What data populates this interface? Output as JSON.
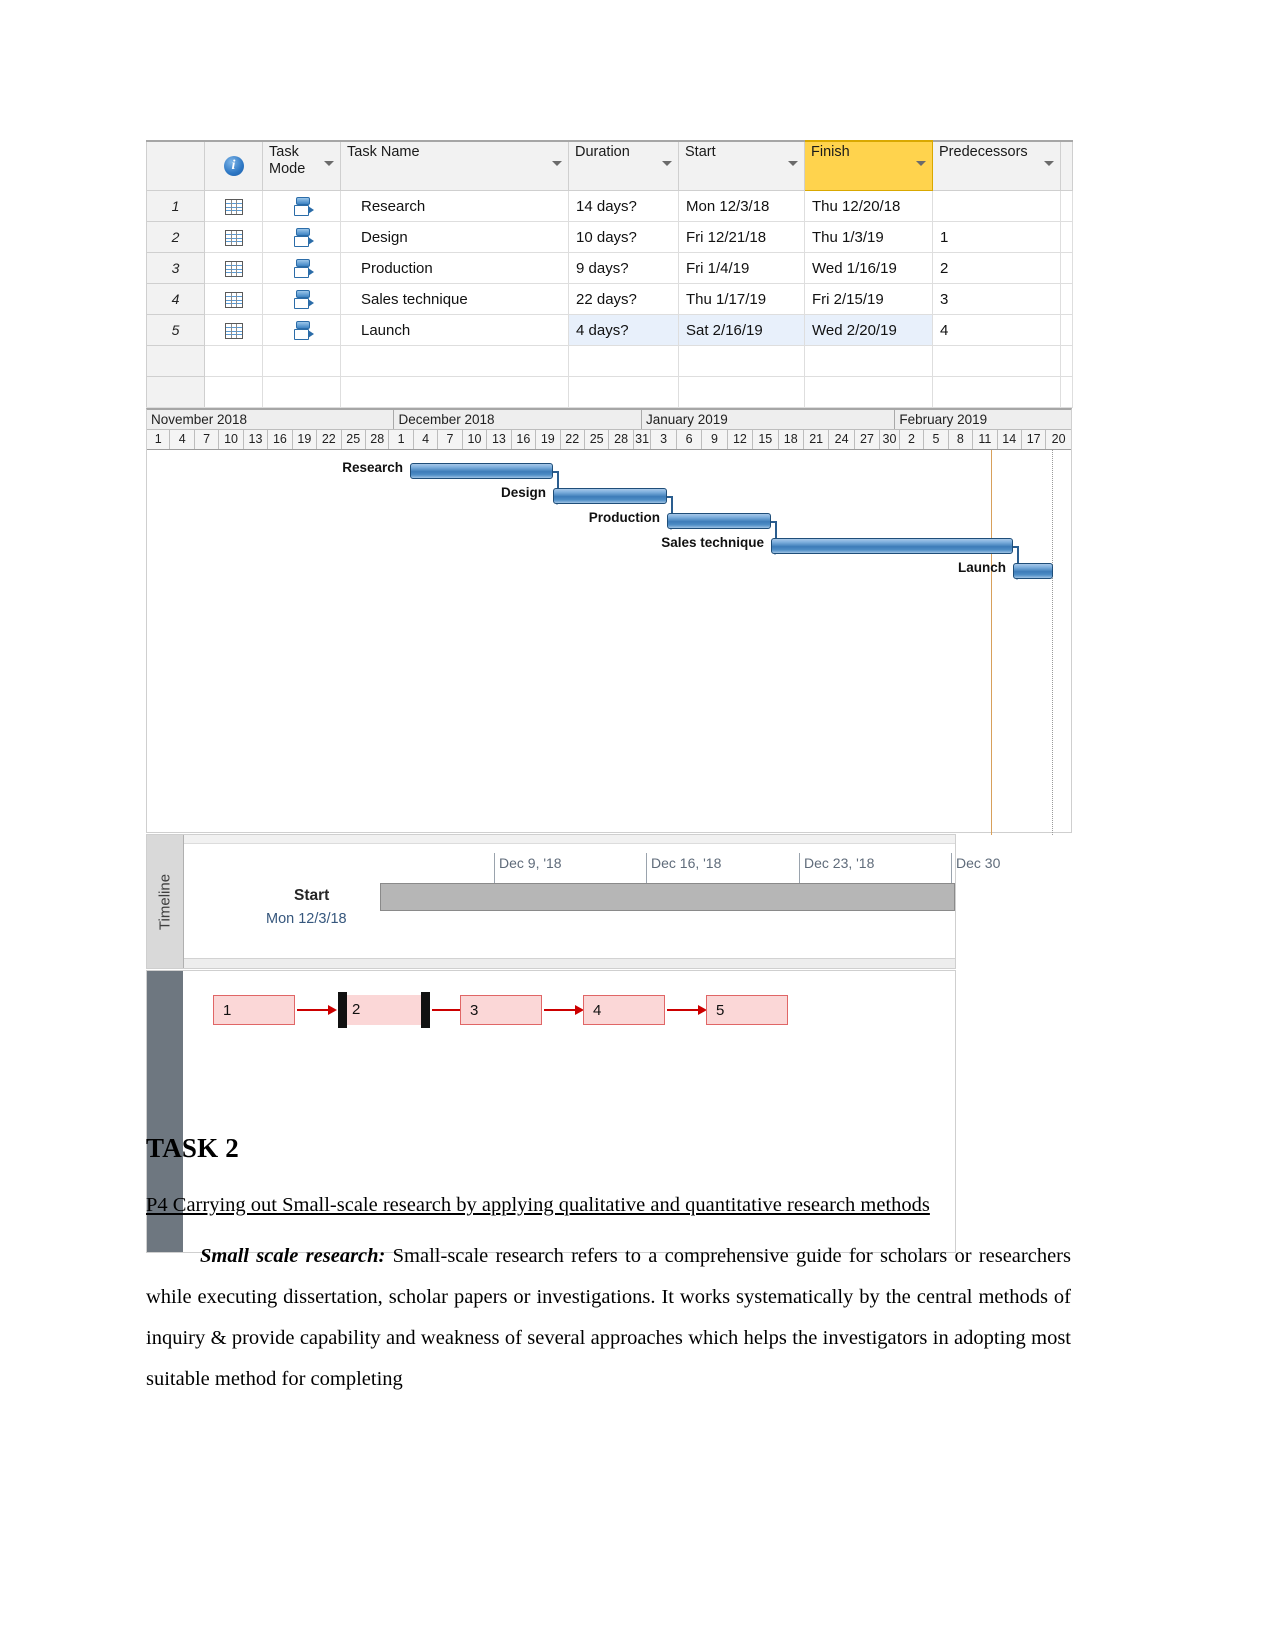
{
  "project": {
    "grid": {
      "columns": [
        {
          "key": "id",
          "label": ""
        },
        {
          "key": "indicator",
          "label": "",
          "icon": "info-icon"
        },
        {
          "key": "mode",
          "label": "Task Mode"
        },
        {
          "key": "name",
          "label": "Task Name"
        },
        {
          "key": "duration",
          "label": "Duration"
        },
        {
          "key": "start",
          "label": "Start"
        },
        {
          "key": "finish",
          "label": "Finish"
        },
        {
          "key": "predecessors",
          "label": "Predecessors"
        }
      ],
      "header_labels": {
        "task_mode": "Task Mode",
        "task_name": "Task Name",
        "duration": "Duration",
        "start": "Start",
        "finish": "Finish",
        "predecessors": "Predecessors"
      },
      "highlight_column": "Finish",
      "highlight_color": "#ffd34d",
      "rows": [
        {
          "id": "1",
          "name": "Research",
          "duration": "14 days?",
          "start": "Mon 12/3/18",
          "finish": "Thu 12/20/18",
          "predecessors": ""
        },
        {
          "id": "2",
          "name": "Design",
          "duration": "10 days?",
          "start": "Fri 12/21/18",
          "finish": "Thu 1/3/19",
          "predecessors": "1"
        },
        {
          "id": "3",
          "name": "Production",
          "duration": "9 days?",
          "start": "Fri 1/4/19",
          "finish": "Wed 1/16/19",
          "predecessors": "2"
        },
        {
          "id": "4",
          "name": "Sales technique",
          "duration": "22 days?",
          "start": "Thu 1/17/19",
          "finish": "Fri 2/15/19",
          "predecessors": "3"
        },
        {
          "id": "5",
          "name": "Launch",
          "duration": "4 days?",
          "start": "Sat 2/16/19",
          "finish": "Wed 2/20/19",
          "predecessors": "4"
        }
      ],
      "selected_row_id": "5"
    },
    "gantt": {
      "months": [
        {
          "label": "November 2018",
          "days": [
            "1",
            "4",
            "7",
            "10",
            "13",
            "16",
            "19",
            "22",
            "25",
            "28"
          ]
        },
        {
          "label": "December 2018",
          "days": [
            "1",
            "4",
            "7",
            "10",
            "13",
            "16",
            "19",
            "22",
            "25",
            "28",
            "31"
          ]
        },
        {
          "label": "January 2019",
          "days": [
            "3",
            "6",
            "9",
            "12",
            "15",
            "18",
            "21",
            "24",
            "27",
            "30"
          ]
        },
        {
          "label": "February 2019",
          "days": [
            "2",
            "5",
            "8",
            "11",
            "14",
            "17",
            "20"
          ]
        }
      ],
      "bars": [
        {
          "label": "Research",
          "label_side": "left"
        },
        {
          "label": "Design",
          "label_side": "left"
        },
        {
          "label": "Production",
          "label_side": "left"
        },
        {
          "label": "Sales technique",
          "label_side": "left"
        },
        {
          "label": "Launch",
          "label_side": "left"
        }
      ],
      "bar_color": "#3d7cb8",
      "bar_border_color": "#1f4e79",
      "progress_line_color": "#d8a05a",
      "link_color": "#2a5d8f"
    },
    "timeline": {
      "pane_label": "Timeline",
      "start_label": "Start",
      "start_date": "Mon 12/3/18",
      "ticks": [
        "Dec 9, '18",
        "Dec 16, '18",
        "Dec 23, '18",
        "Dec 30"
      ],
      "bar_color": "#b6b6b6"
    },
    "network": {
      "nodes": [
        "1",
        "2",
        "3",
        "4",
        "5"
      ],
      "selected_node": "2",
      "node_fill": "#fbd7d7",
      "node_border": "#e06666",
      "arrow_color": "#cc0000"
    }
  },
  "document": {
    "heading": "TASK 2",
    "subheading": "P4 Carrying out Small-scale research by applying qualitative and quantitative research methods",
    "paragraph_lead": "Small scale research:",
    "paragraph_body": " Small-scale research refers to a comprehensive guide for scholars or researchers while executing dissertation, scholar papers or investigations. It works systematically by the central methods of inquiry & provide capability and weakness of several approaches which helps the investigators in adopting most suitable method for completing"
  }
}
